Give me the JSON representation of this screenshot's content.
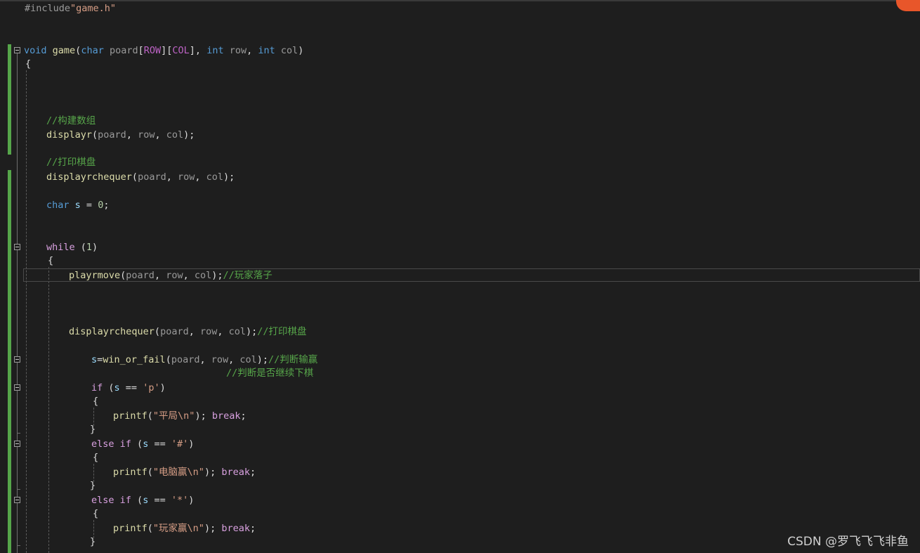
{
  "code": {
    "include_directive": "#include",
    "include_file": "\"game.h\"",
    "kw_void": "void",
    "fn_game": "game",
    "kw_char": "char",
    "kw_int": "int",
    "param_poard": "poard",
    "param_row": "row",
    "param_col": "col",
    "macro_row": "ROW",
    "macro_col": "COL",
    "fn_displayr": "displayr",
    "fn_displayrchequer": "displayrchequer",
    "fn_playrmove": "playrmove",
    "fn_win_or_fail": "win_or_fail",
    "fn_printf": "printf",
    "var_s": "s",
    "num_zero": "0",
    "num_one": "1",
    "kw_while": "while",
    "kw_if": "if",
    "kw_else": "else",
    "kw_break": "break",
    "char_p": "'p'",
    "char_hash": "'#'",
    "char_star": "'*'",
    "comment_build_array": "//构建数组",
    "comment_print_board": "//打印棋盘",
    "comment_player_move": "//玩家落子",
    "comment_judge_win": "//判断输赢",
    "comment_judge_continue": "//判断是否继续下棋",
    "str_draw": "\"平局\\n\"",
    "str_computer_win": "\"电脑赢\\n\"",
    "str_player_win": "\"玩家赢\\n\""
  },
  "watermark": "CSDN @罗飞飞飞非鱼",
  "colors": {
    "background": "#1e1e1e",
    "keyword": "#569cd6",
    "control_keyword": "#d8a0df",
    "comment": "#57a64a",
    "string": "#d69d85",
    "function": "#dcdcaa",
    "macro": "#bd63c5",
    "change_bar": "#56a64a"
  }
}
